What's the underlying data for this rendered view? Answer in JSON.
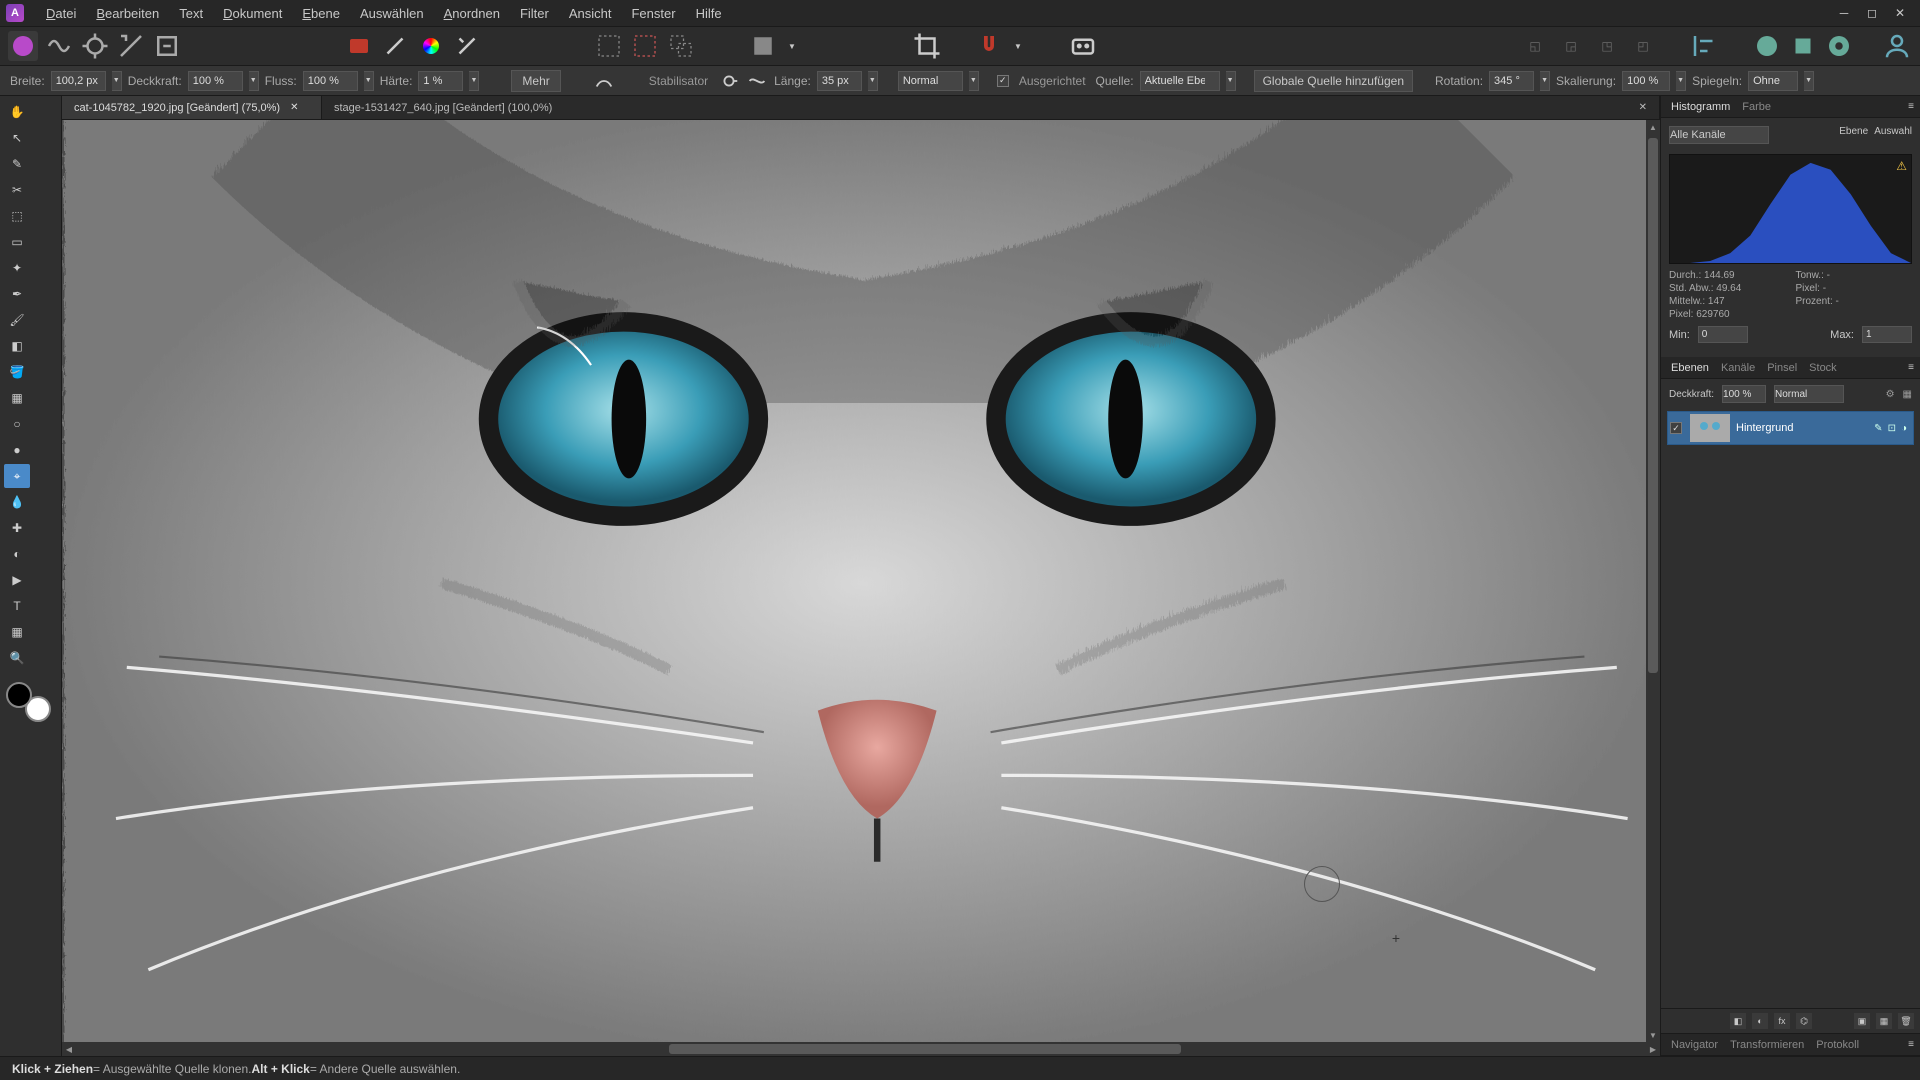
{
  "app": {
    "logo_letter": "A"
  },
  "menu": [
    "Datei",
    "Bearbeiten",
    "Text",
    "Dokument",
    "Ebene",
    "Auswählen",
    "Anordnen",
    "Filter",
    "Ansicht",
    "Fenster",
    "Hilfe"
  ],
  "context_toolbar": {
    "breite_label": "Breite:",
    "breite_value": "100,2 px",
    "deckkraft_label": "Deckkraft:",
    "deckkraft_value": "100 %",
    "fluss_label": "Fluss:",
    "fluss_value": "100 %",
    "haerte_label": "Härte:",
    "haerte_value": "1 %",
    "mehr": "Mehr",
    "stabilisator": "Stabilisator",
    "laenge_label": "Länge:",
    "laenge_value": "35 px",
    "blend_mode": "Normal",
    "ausgerichtet": "Ausgerichtet",
    "quelle_label": "Quelle:",
    "quelle_value": "Aktuelle Ebene",
    "globale_quelle": "Globale Quelle hinzufügen",
    "rotation_label": "Rotation:",
    "rotation_value": "345 °",
    "skalierung_label": "Skalierung:",
    "skalierung_value": "100 %",
    "spiegeln_label": "Spiegeln:",
    "spiegeln_value": "Ohne"
  },
  "tabs": [
    {
      "label": "cat-1045782_1920.jpg [Geändert] (75,0%)",
      "active": true
    },
    {
      "label": "stage-1531427_640.jpg [Geändert] (100,0%)",
      "active": false
    }
  ],
  "histogram": {
    "tabs": [
      "Histogramm",
      "Farbe"
    ],
    "channel": "Alle Kanäle",
    "view_modes": [
      "Ebene",
      "Auswahl"
    ],
    "stats": {
      "durch": "Durch.: 144.69",
      "ton": "Tonw.: -",
      "std": "Std. Abw.: 49.64",
      "pixel_lbl": "Pixel: -",
      "mittel": "Mittelw.: 147",
      "prozent": "Prozent: -",
      "pixel": "Pixel: 629760"
    },
    "min_label": "Min:",
    "min_value": "0",
    "max_label": "Max:",
    "max_value": "1"
  },
  "layers_panel": {
    "tabs": [
      "Ebenen",
      "Kanäle",
      "Pinsel",
      "Stock"
    ],
    "deckkraft_label": "Deckkraft:",
    "deckkraft_value": "100 %",
    "blend": "Normal",
    "layer_name": "Hintergrund"
  },
  "bottom_tabs": [
    "Navigator",
    "Transformieren",
    "Protokoll"
  ],
  "status": {
    "line": "Klick + Ziehen = Ausgewählte Quelle klonen. Alt + Klick = Andere Quelle auswählen.",
    "b1": "Klick + Ziehen",
    "t1": " = Ausgewählte Quelle klonen. ",
    "b2": "Alt + Klick",
    "t2": " = Andere Quelle auswählen."
  },
  "chart_data": {
    "type": "area",
    "description": "Luminance histogram of active image",
    "x_range": [
      0,
      255
    ],
    "series": [
      {
        "name": "All channels",
        "values": [
          0,
          0,
          0,
          1,
          2,
          3,
          5,
          7,
          10,
          14,
          19,
          25,
          32,
          40,
          49,
          58,
          68,
          78,
          88,
          98,
          106,
          113,
          119,
          123,
          126,
          128,
          128,
          127,
          124,
          120,
          114,
          106,
          97,
          86,
          74,
          62,
          50,
          39,
          29,
          20,
          13,
          8,
          4,
          2,
          1,
          0,
          0,
          0,
          0,
          0,
          0
        ]
      }
    ],
    "color": "#3a63c9"
  }
}
